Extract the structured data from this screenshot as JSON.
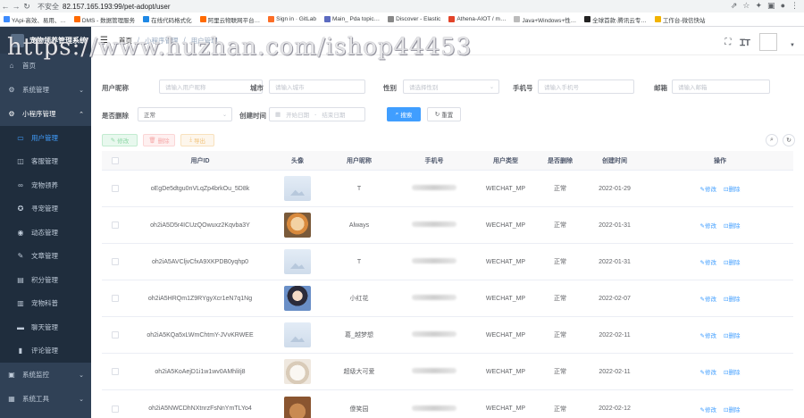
{
  "browser": {
    "insecure_label": "不安全",
    "url": "82.157.165.193:99/pet-adopt/user",
    "bookmarks": [
      "YApi-高效、易用、…",
      "DMS - 数据管理服务",
      "在线代码格式化",
      "阿里云物联网平台…",
      "Sign in · GitLab",
      "Main_ Pda topic…",
      "Discover - Elastic",
      "Athena-AIOT / m…",
      "Java+Windows+性…",
      "全球首款·腾讯云专…",
      "工作台-微信快站"
    ]
  },
  "watermark": "https://www.huzhan.com/ishop44453",
  "sidebar": {
    "title": "宠物领养管理系统",
    "items": [
      {
        "label": "首页",
        "icon": "home-icon"
      },
      {
        "label": "系统管理",
        "icon": "gear-icon"
      },
      {
        "label": "小程序管理",
        "icon": "gear-icon"
      }
    ],
    "sub_items": [
      {
        "label": "用户管理",
        "icon": "user-icon"
      },
      {
        "label": "客服管理",
        "icon": "service-icon"
      },
      {
        "label": "宠物领养",
        "icon": "paw-icon"
      },
      {
        "label": "寻宠管理",
        "icon": "search-pet-icon"
      },
      {
        "label": "动态管理",
        "icon": "dynamic-icon"
      },
      {
        "label": "文章管理",
        "icon": "article-icon"
      },
      {
        "label": "积分管理",
        "icon": "points-icon"
      },
      {
        "label": "宠物科普",
        "icon": "book-icon"
      },
      {
        "label": "聊天管理",
        "icon": "chat-icon"
      },
      {
        "label": "评论管理",
        "icon": "comment-icon"
      }
    ],
    "bottom_items": [
      {
        "label": "系统监控",
        "icon": "monitor-icon"
      },
      {
        "label": "系统工具",
        "icon": "tool-icon"
      }
    ]
  },
  "breadcrumb": [
    "首页",
    "小程序管理",
    "用户管理"
  ],
  "form": {
    "nickname_label": "用户昵称",
    "nickname_placeholder": "请输入用户昵称",
    "city_label": "城市",
    "city_placeholder": "请输入城市",
    "gender_label": "性别",
    "gender_placeholder": "请选择性别",
    "phone_label": "手机号",
    "phone_placeholder": "请输入手机号",
    "email_label": "邮箱",
    "email_placeholder": "请输入邮箱",
    "deleted_label": "是否删除",
    "deleted_value": "正常",
    "created_label": "创建时间",
    "start_placeholder": "开始日期",
    "range_sep": "-",
    "end_placeholder": "结束日期",
    "search_button": "搜索",
    "reset_button": "重置"
  },
  "toolbar": {
    "edit": "修改",
    "delete": "删除",
    "export": "导出"
  },
  "table": {
    "headers": [
      "用户ID",
      "头像",
      "用户昵称",
      "手机号",
      "用户类型",
      "是否删除",
      "创建时间",
      "操作"
    ],
    "edit_label": "修改",
    "delete_label": "删除",
    "rows": [
      {
        "id": "oEgDe5dtgu0nVLqZp4brkOu_5D8k",
        "avatar": "placeholder",
        "nickname": "T",
        "type": "WECHAT_MP",
        "deleted": "正常",
        "created": "2022-01-29"
      },
      {
        "id": "oh2iA5D5r4ICUzQOwuxz2Kqvba3Y",
        "avatar": "dog",
        "nickname": "Always",
        "type": "WECHAT_MP",
        "deleted": "正常",
        "created": "2022-01-31"
      },
      {
        "id": "oh2iA5AVCljvCfxA9XKPDB0yqhp0",
        "avatar": "placeholder",
        "nickname": "T",
        "type": "WECHAT_MP",
        "deleted": "正常",
        "created": "2022-01-31"
      },
      {
        "id": "oh2iA5HRQm1Z9RYgyXcr1eN7q1Ng",
        "avatar": "girl",
        "nickname": "小红花",
        "type": "WECHAT_MP",
        "deleted": "正常",
        "created": "2022-02-07"
      },
      {
        "id": "oh2iA5KQa5xLWmChtmY-JVvKRWEE",
        "avatar": "placeholder",
        "nickname": "葛_越梦想",
        "type": "WECHAT_MP",
        "deleted": "正常",
        "created": "2022-02-11"
      },
      {
        "id": "oh2iA5KoAejD1i1w1wv0AMhliIj8",
        "avatar": "cat",
        "nickname": "超级大可爱",
        "type": "WECHAT_MP",
        "deleted": "正常",
        "created": "2022-02-11"
      },
      {
        "id": "oh2iA5NWCDhNXtnrzFsNnYmTLYo4",
        "avatar": "brown",
        "nickname": "傻笑园",
        "type": "WECHAT_MP",
        "deleted": "正常",
        "created": "2022-02-12"
      }
    ]
  }
}
